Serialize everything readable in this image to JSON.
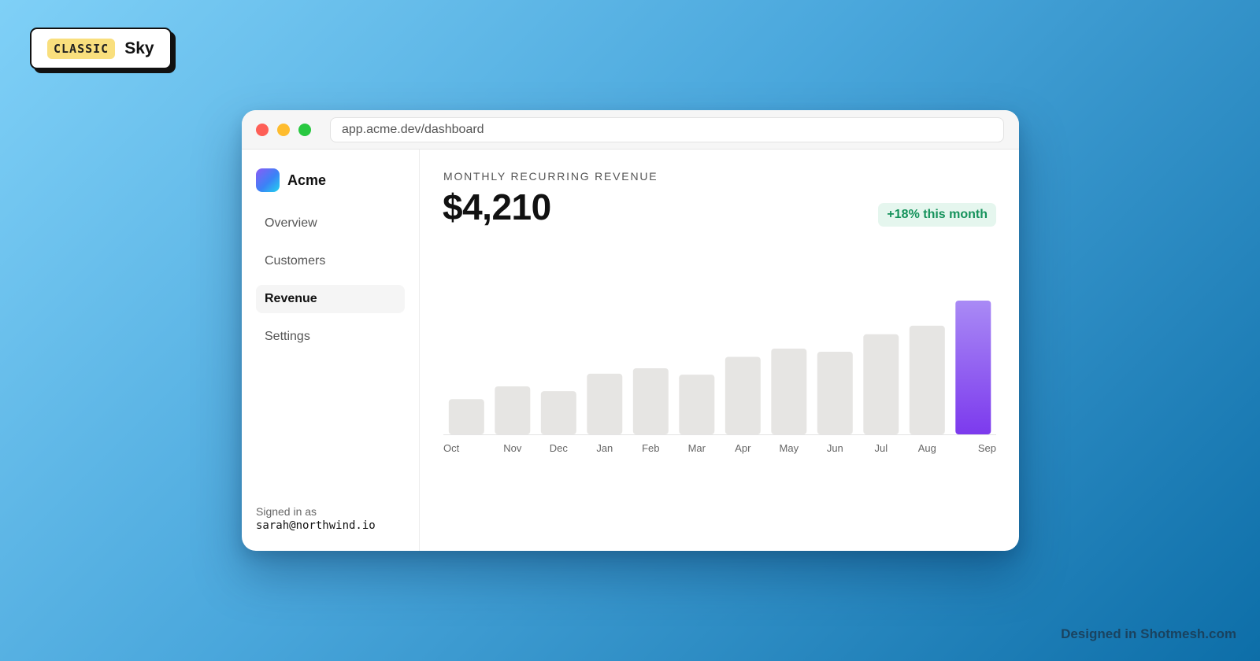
{
  "badge": {
    "tag": "CLASSIC",
    "name": "Sky"
  },
  "browser": {
    "url": "app.acme.dev/dashboard"
  },
  "sidebar": {
    "brand": "Acme",
    "items": [
      {
        "label": "Overview",
        "active": false
      },
      {
        "label": "Customers",
        "active": false
      },
      {
        "label": "Revenue",
        "active": true
      },
      {
        "label": "Settings",
        "active": false
      }
    ],
    "signed_in_label": "Signed in as",
    "signed_in_email": "sarah@northwind.io"
  },
  "main": {
    "metric_label": "MONTHLY RECURRING REVENUE",
    "metric_value": "$4,210",
    "delta": "+18% this month"
  },
  "colors": {
    "bar_default": "#e6e5e3",
    "bar_highlight_top": "#a98af5",
    "bar_highlight_bottom": "#7c3aed",
    "delta_text": "#15925b",
    "delta_bg": "#e5f6ee"
  },
  "chart_data": {
    "type": "bar",
    "categories": [
      "Oct",
      "Nov",
      "Dec",
      "Jan",
      "Feb",
      "Mar",
      "Apr",
      "May",
      "Jun",
      "Jul",
      "Aug",
      "Sep"
    ],
    "values": [
      1110,
      1510,
      1360,
      1910,
      2080,
      1880,
      2440,
      2700,
      2600,
      3150,
      3420,
      4210
    ],
    "highlight_index": 11,
    "title": "",
    "xlabel": "",
    "ylabel": "",
    "ylim": [
      0,
      4210
    ],
    "grid": false,
    "legend": "none"
  },
  "footer": {
    "credit": "Designed in Shotmesh.com"
  }
}
